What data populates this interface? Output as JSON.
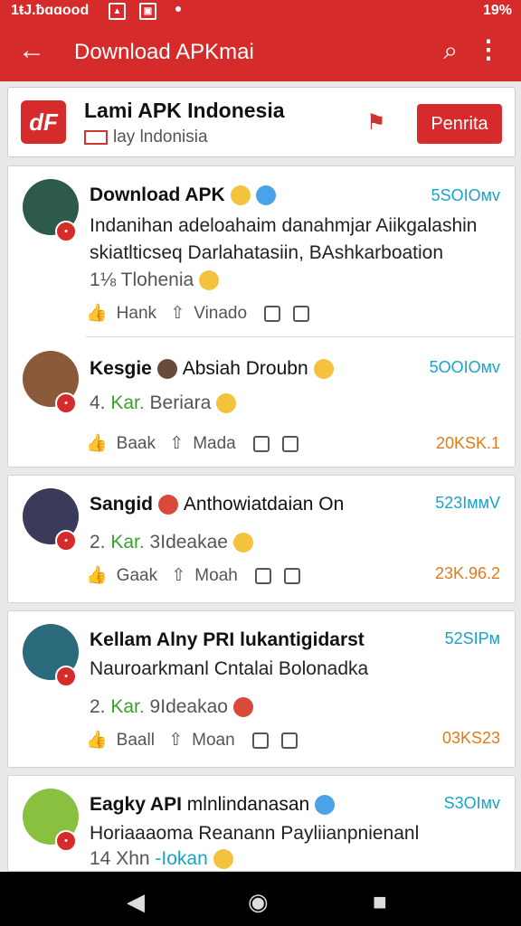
{
  "status": {
    "left": "1ŧJ.ƀɑɑood",
    "right": "19%"
  },
  "appbar": {
    "title": "Download APKmai"
  },
  "banner": {
    "name": "Lami APK Indonesia",
    "sub": "lay lndonisia",
    "button": "Penrita"
  },
  "items": [
    {
      "name": "Download APK",
      "time": "5SOIOᴍv",
      "line1": "Indanihan adeloahaim danahmjar Aiikgalashin",
      "line2": "skiatlticseq Darlahatasiin, BAshkarboation",
      "meta1": "1⅛ Tlohenia",
      "actions": [
        "Hank",
        "Vinado"
      ]
    },
    {
      "name": "Kesgie",
      "name_extra": "Absiah Droubn",
      "time": "5OOIOᴍv",
      "line1_prefix": "4. ",
      "line1_green": "Kar.",
      "line1_rest": " Beriara",
      "actions": [
        "Baak",
        "Mada"
      ],
      "count": "20KSK.1"
    },
    {
      "name": "Sangid",
      "name_extra": "Anthowiatdaian On",
      "time": "523IᴍᴍV",
      "line1_prefix": "2. ",
      "line1_green": "Kar.",
      "line1_rest": " 3Ideakae",
      "actions": [
        "Gaak",
        "Moah"
      ],
      "count": "23K.96.2"
    },
    {
      "name": "Kellam Alny PRI lukantigidarst",
      "time": "52SIPᴍ",
      "line1": "Nauroarkmanl Cntalai Bolonadka",
      "line1_prefix": "2. ",
      "line1_green": "Kar.",
      "line1_rest": " 9Ideakao",
      "actions": [
        "Baall",
        "Moan"
      ],
      "count": "03KS23"
    },
    {
      "name": "Eagky API",
      "name_extra": "mlnlindanasan",
      "time": "S3OIᴍv",
      "line1": "Horiaaaoma Reanann Payliianpnienanl",
      "meta1": "14 Xhn",
      "meta_green": "-Iokan"
    }
  ]
}
